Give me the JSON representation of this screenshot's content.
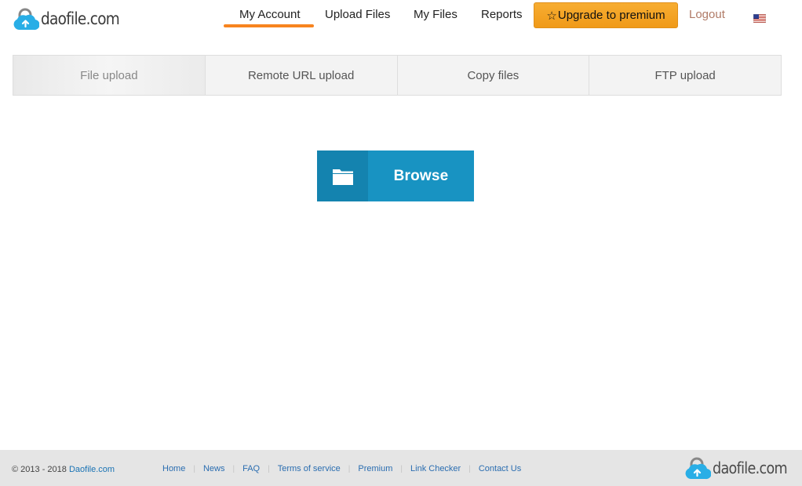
{
  "brand": {
    "name": "daofile.com",
    "accent": "#f7841f",
    "cloud_color": "#29aee6"
  },
  "nav": {
    "my_account": "My Account",
    "upload_files": "Upload Files",
    "my_files": "My Files",
    "reports": "Reports",
    "upgrade_star": "☆",
    "upgrade": "Upgrade to premium",
    "logout": "Logout",
    "language_icon": "us-flag-icon"
  },
  "tabs": [
    {
      "label": "File upload",
      "active": true
    },
    {
      "label": "Remote URL upload",
      "active": false
    },
    {
      "label": "Copy files",
      "active": false
    },
    {
      "label": "FTP upload",
      "active": false
    }
  ],
  "upload": {
    "browse_label": "Browse",
    "icon": "folder-icon"
  },
  "footer": {
    "copyright_prefix": "© 2013 - 2018",
    "copyright_link": "Daofile.com",
    "links": [
      "Home",
      "News",
      "FAQ",
      "Terms of service",
      "Premium",
      "Link Checker",
      "Contact Us"
    ],
    "separator": "|",
    "brand_name": "daofile.com"
  }
}
